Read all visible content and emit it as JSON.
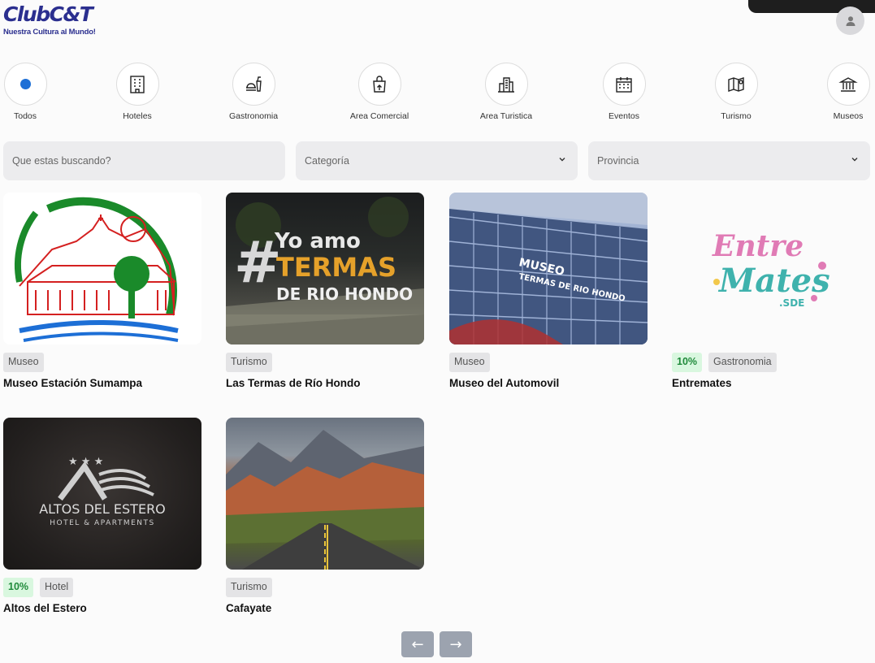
{
  "header": {
    "logo_text": "ClubC&T",
    "logo_tagline": "Nuestra Cultura al Mundo!"
  },
  "categories": [
    {
      "label": "Todos",
      "icon": "dot-icon"
    },
    {
      "label": "Hoteles",
      "icon": "hotel-icon"
    },
    {
      "label": "Gastronomia",
      "icon": "food-icon"
    },
    {
      "label": "Area Comercial",
      "icon": "shopping-bag-icon"
    },
    {
      "label": "Area Turistica",
      "icon": "city-icon"
    },
    {
      "label": "Eventos",
      "icon": "calendar-icon"
    },
    {
      "label": "Turismo",
      "icon": "map-icon"
    },
    {
      "label": "Museos",
      "icon": "museum-icon"
    }
  ],
  "filters": {
    "search_placeholder": "Que estas buscando?",
    "category_label": "Categoría",
    "province_label": "Provincia"
  },
  "cards": [
    {
      "title": "Museo Estación Sumampa",
      "tags": [
        "Museo"
      ],
      "discount": ""
    },
    {
      "title": "Las Termas de Río Hondo",
      "tags": [
        "Turismo"
      ],
      "discount": "",
      "image_text": [
        "Yo amo",
        "TERMAS",
        "DE RIO HONDO"
      ]
    },
    {
      "title": "Museo del Automovil",
      "tags": [
        "Museo"
      ],
      "discount": "",
      "image_text": [
        "MUSEO",
        "TERMAS DE RIO HONDO"
      ]
    },
    {
      "title": "Entremates",
      "tags": [
        "Gastronomia"
      ],
      "discount": "10%",
      "image_text": [
        "Entre",
        "Mates",
        ".SDE"
      ]
    },
    {
      "title": "Altos del Estero",
      "tags": [
        "Hotel"
      ],
      "discount": "10%",
      "image_text": [
        "ALTOS DEL ESTERO",
        "HOTEL & APARTMENTS"
      ]
    },
    {
      "title": "Cafayate",
      "tags": [
        "Turismo"
      ],
      "discount": ""
    }
  ],
  "pager": {
    "prev": "←",
    "next": "→"
  },
  "colors": {
    "brand": "#2b2f8f",
    "accent_dot": "#1d6fd6",
    "discount_bg": "#d9f7df",
    "discount_text": "#1f8a3a",
    "pager": "#9ca3af"
  }
}
